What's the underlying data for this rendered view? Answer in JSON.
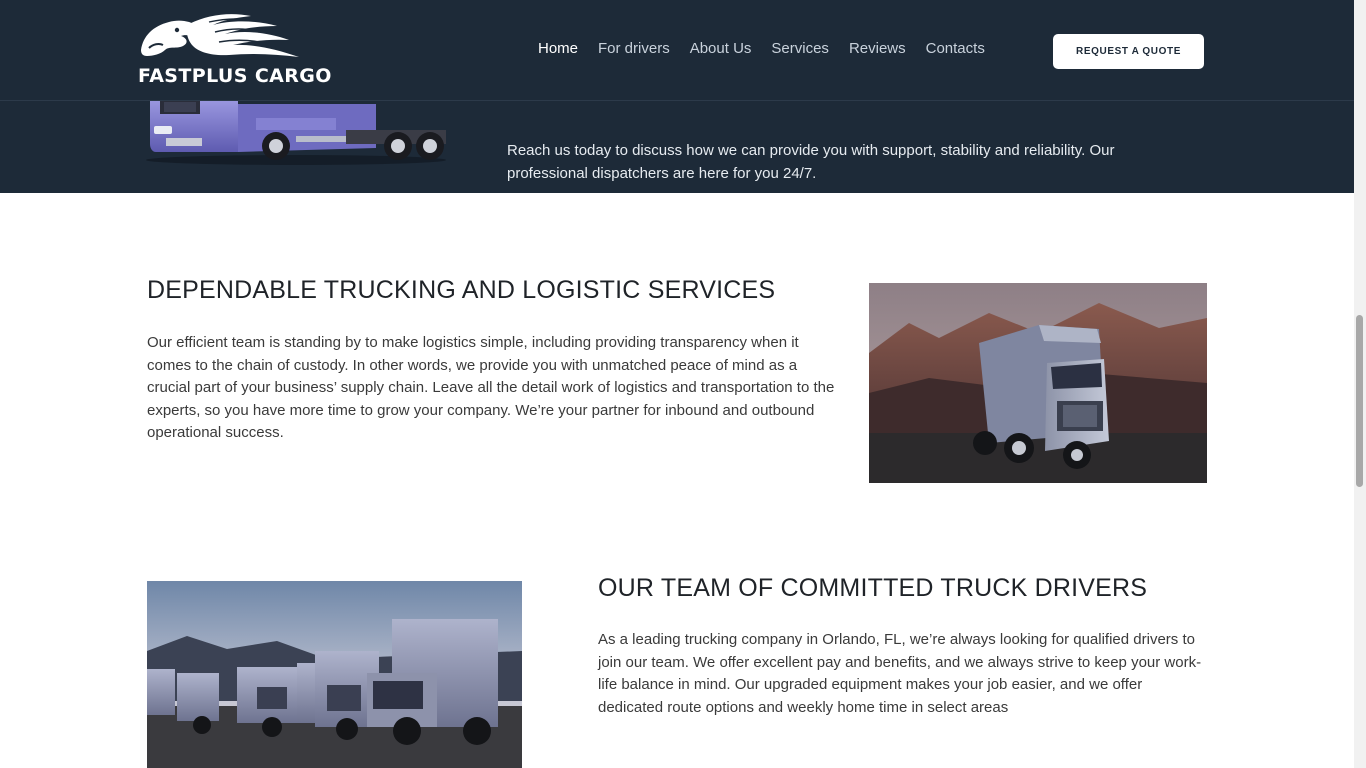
{
  "brand": {
    "name": "FASTPLUS CARGO",
    "logo_icon": "jaguar-flame-icon"
  },
  "nav": {
    "items": [
      {
        "label": "Home",
        "active": true
      },
      {
        "label": "For drivers",
        "active": false
      },
      {
        "label": "About Us",
        "active": false
      },
      {
        "label": "Services",
        "active": false
      },
      {
        "label": "Reviews",
        "active": false
      },
      {
        "label": "Contacts",
        "active": false
      }
    ],
    "cta_label": "REQUEST A QUOTE"
  },
  "hero": {
    "text": "Reach us today to discuss how we can provide you with support, stability and reliability. Our professional dispatchers are here for you 24/7."
  },
  "sections": [
    {
      "title": "DEPENDABLE TRUCKING AND LOGISTIC SERVICES",
      "body": "Our efficient team is standing by to make logistics simple, including providing transparency when it comes to the chain of custody. In other words, we provide you with unmatched peace of mind as a crucial part of your business’ supply chain. Leave all the detail work of logistics and transportation to the experts, so you have more time to grow your company. We’re your partner for inbound and outbound operational success."
    },
    {
      "title": "OUR TEAM OF COMMITTED TRUCK DRIVERS",
      "body": "As a leading trucking company in Orlando, FL, we’re always looking for qualified drivers to join our team. We offer excellent pay and benefits, and we always strive to keep your work-life balance in mind. Our upgraded equipment makes your job easier, and we offer dedicated route options and weekly home time in select areas"
    }
  ],
  "colors": {
    "header_bg": "#1d2a38",
    "text_dark": "#1f2328",
    "truck_purple": "#7b78c9"
  }
}
